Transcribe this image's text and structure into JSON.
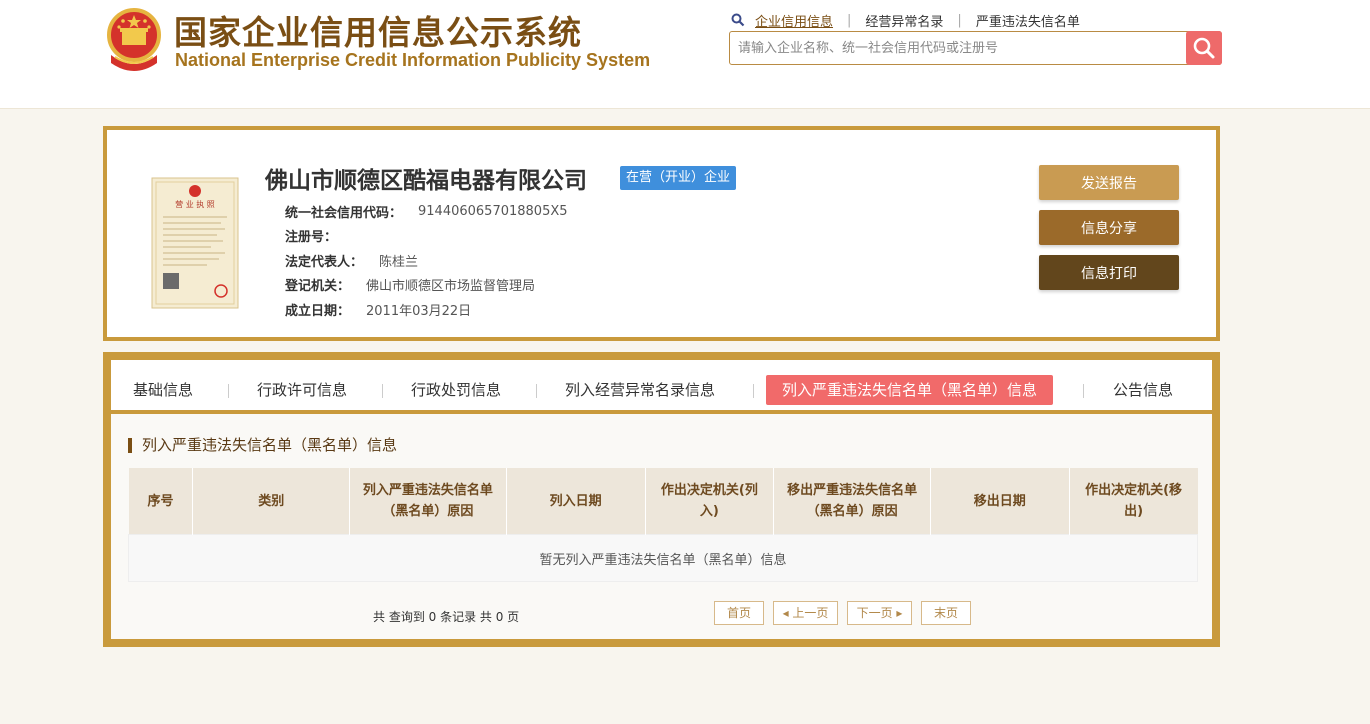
{
  "header": {
    "title_cn": "国家企业信用信息公示系统",
    "title_en": "National Enterprise Credit Information Publicity System",
    "nav": [
      "企业信用信息",
      "经营异常名录",
      "严重违法失信名单"
    ],
    "search_placeholder": "请输入企业名称、统一社会信用代码或注册号"
  },
  "company": {
    "name": "佛山市顺德区酷福电器有限公司",
    "status": "在营（开业）企业",
    "fields": [
      {
        "label": "统一社会信用代码：",
        "value": "9144060657018805X5"
      },
      {
        "label": "注册号：",
        "value": ""
      },
      {
        "label": "法定代表人：",
        "value": "陈桂兰"
      },
      {
        "label": "登记机关：",
        "value": "佛山市顺德区市场监督管理局"
      },
      {
        "label": "成立日期：",
        "value": "2011年03月22日"
      }
    ],
    "license_label": "营业执照"
  },
  "actions": {
    "send_report": "发送报告",
    "share": "信息分享",
    "print": "信息打印"
  },
  "tabs": [
    "基础信息",
    "行政许可信息",
    "行政处罚信息",
    "列入经营异常名录信息",
    "列入严重违法失信名单（黑名单）信息",
    "公告信息"
  ],
  "section": {
    "title": "列入严重违法失信名单（黑名单）信息",
    "columns": [
      "序号",
      "类别",
      "列入严重违法失信名单（黑名单）原因",
      "列入日期",
      "作出决定机关(列入)",
      "移出严重违法失信名单（黑名单）原因",
      "移出日期",
      "作出决定机关(移出)"
    ],
    "empty_text": "暂无列入严重违法失信名单（黑名单）信息"
  },
  "pagination": {
    "summary": "共 查询到 0 条记录 共 0 页",
    "first": "首页",
    "prev": "◂ 上一页",
    "next": "下一页 ▸",
    "last": "末页"
  },
  "colors": {
    "gold_border": "#c99a3c",
    "active_tab": "#f16a6a",
    "status_badge": "#3f8fdc",
    "search_button": "#ee6a6a"
  }
}
